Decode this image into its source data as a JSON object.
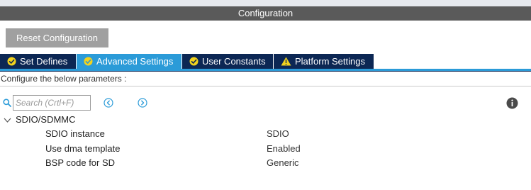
{
  "window": {
    "title": "Configuration"
  },
  "toolbar": {
    "reset_label": "Reset Configuration"
  },
  "tabs": [
    {
      "label": "Set Defines",
      "icon": "check-circle-icon",
      "active": false
    },
    {
      "label": "Advanced Settings",
      "icon": "check-circle-icon",
      "active": true
    },
    {
      "label": "User Constants",
      "icon": "check-circle-icon",
      "active": false
    },
    {
      "label": "Platform Settings",
      "icon": "warning-icon",
      "active": false
    }
  ],
  "main": {
    "instruction": "Configure the below parameters :",
    "search": {
      "placeholder": "Search (Crtl+F)",
      "value": ""
    },
    "group": {
      "label": "SDIO/SDMMC",
      "expanded": true,
      "params": [
        {
          "name": "SDIO instance",
          "value": "SDIO"
        },
        {
          "name": "Use dma template",
          "value": "Enabled"
        },
        {
          "name": "BSP code for SD",
          "value": "Generic"
        }
      ]
    }
  },
  "colors": {
    "title_bar": "#5a5a5a",
    "tab_dark": "#0c2754",
    "tab_active": "#2b9bd8",
    "check_icon": "#f2d21d",
    "warning_icon": "#f2d21d",
    "button_bg": "#a0a0a0",
    "nav_icon": "#2b9bd8"
  }
}
